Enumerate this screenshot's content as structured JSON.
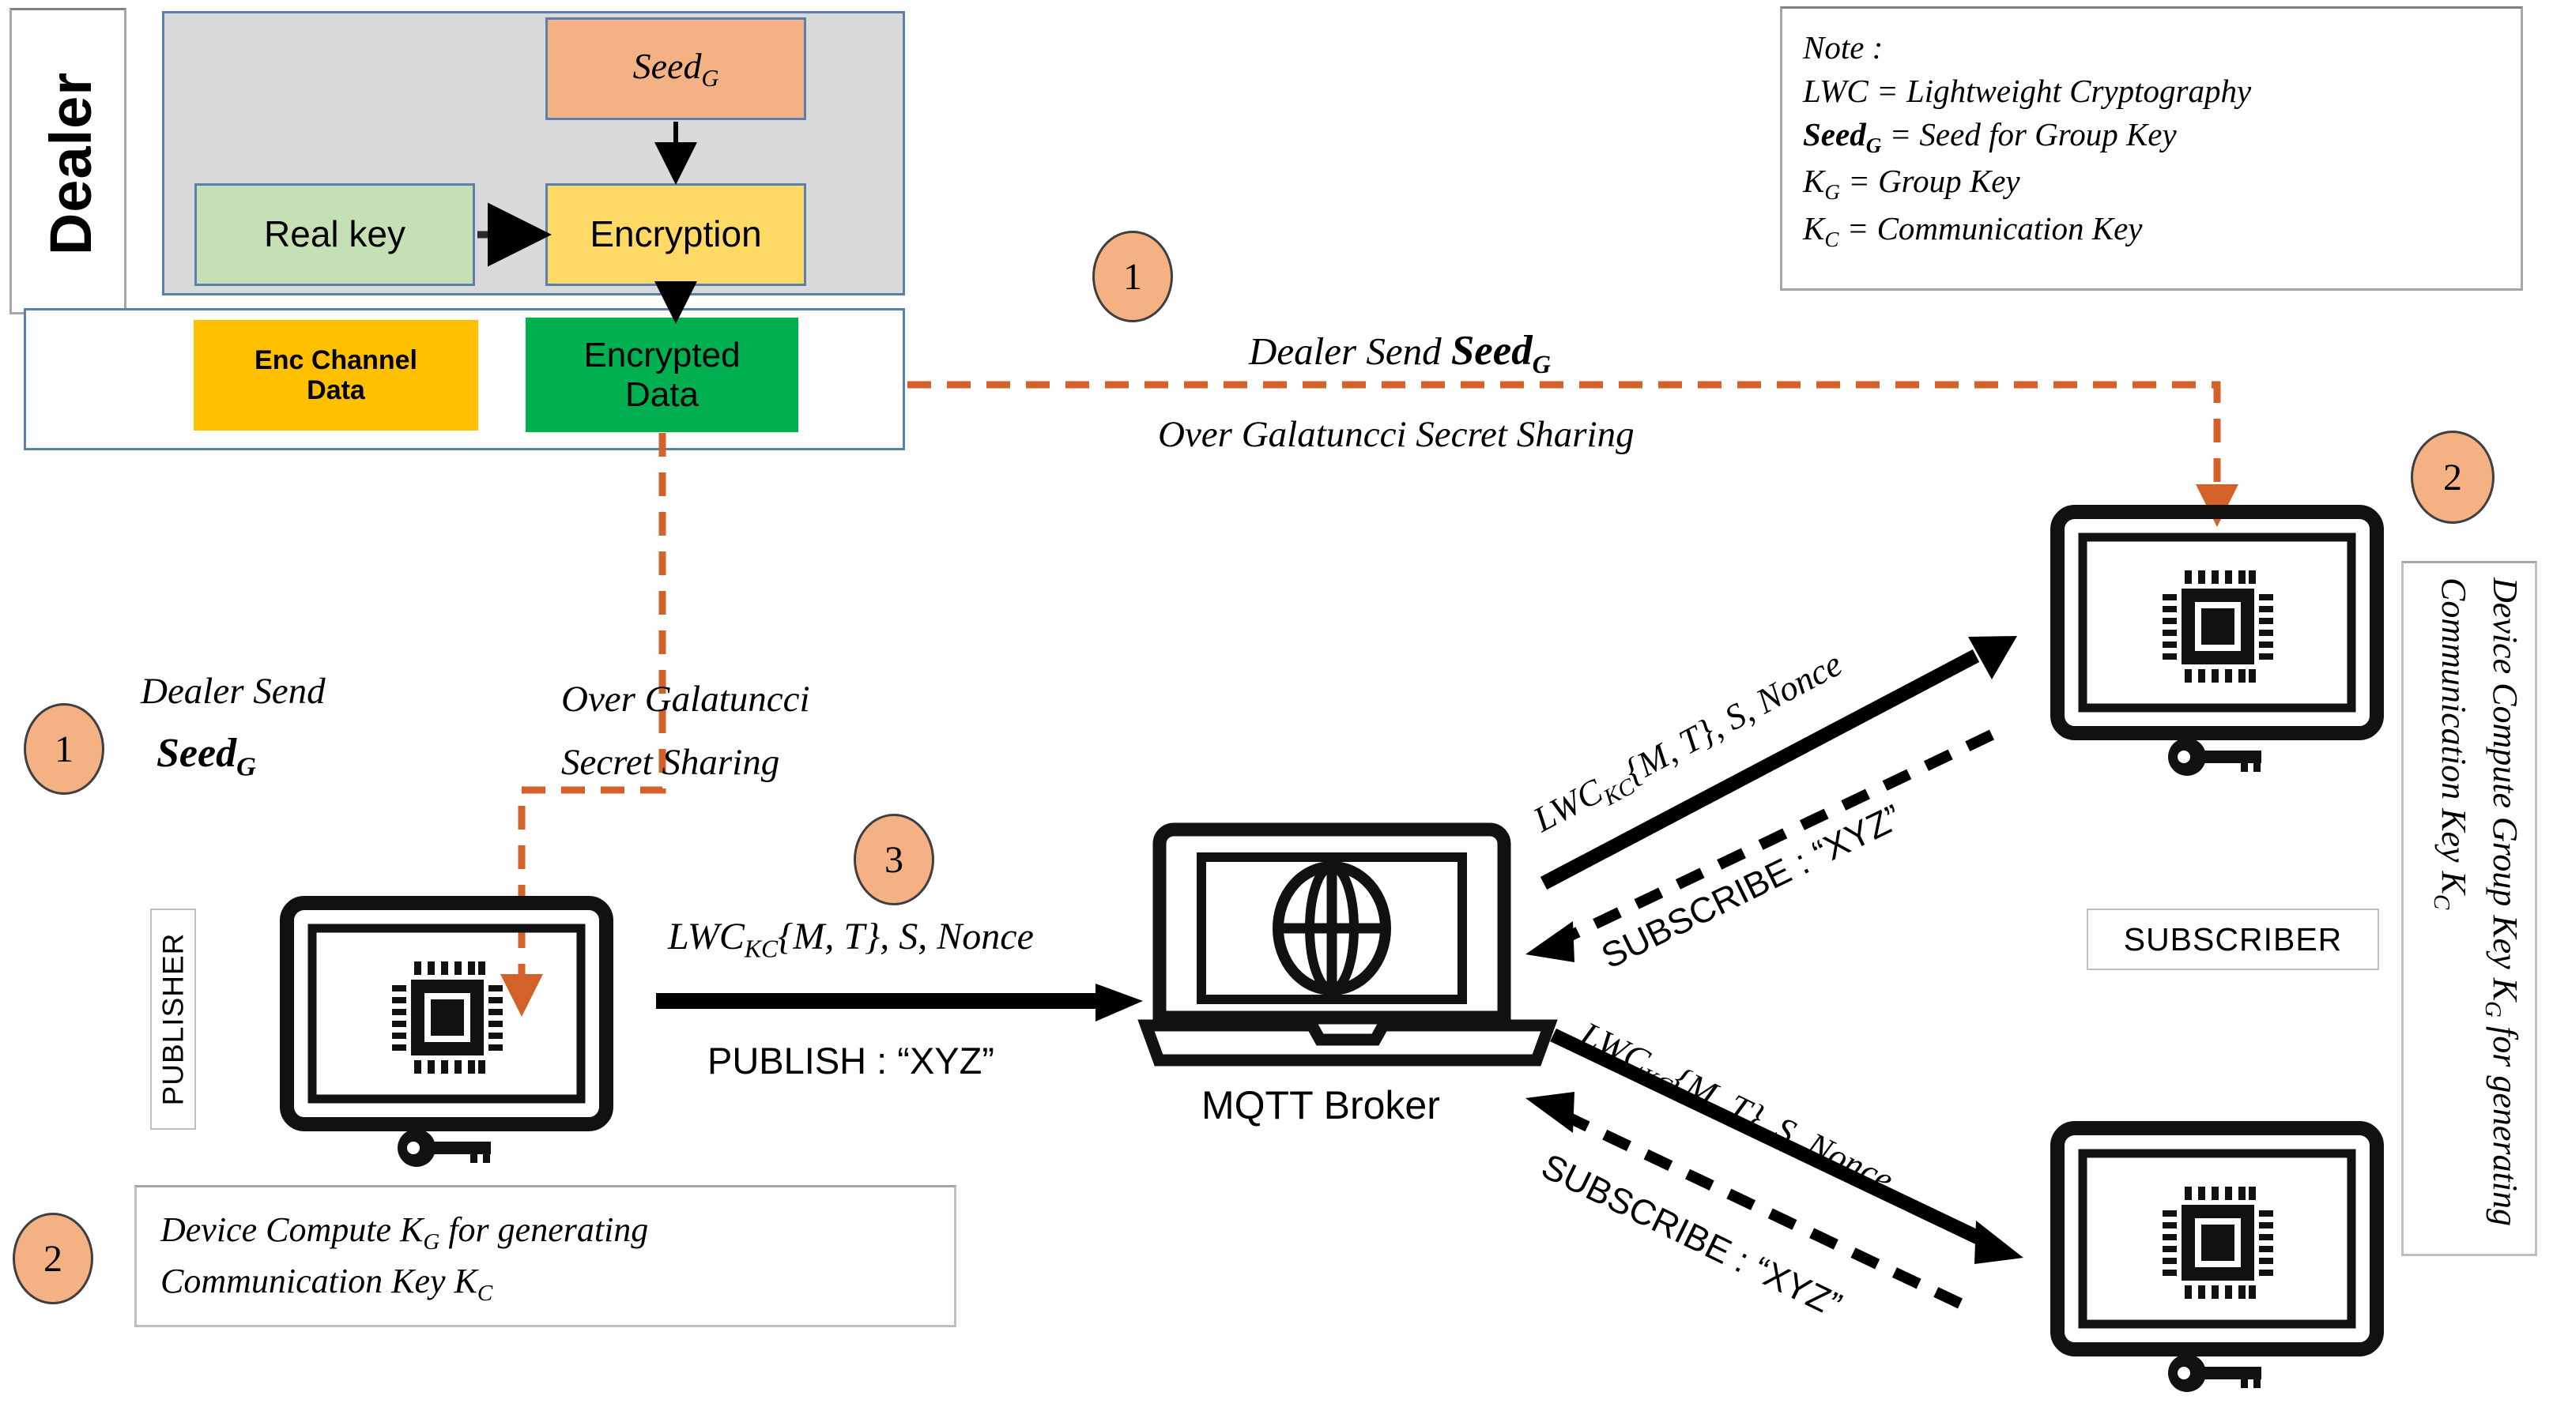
{
  "dealer": {
    "label": "Dealer",
    "boxes": {
      "seed": "Seed",
      "seed_sub": "G",
      "real_key": "Real key",
      "encryption": "Encryption",
      "enc_channel_line1": "Enc Channel",
      "enc_channel_line2": "Data",
      "encrypted_line1": "Encrypted",
      "encrypted_line2": "Data"
    },
    "colors": {
      "seed": "#f4b183",
      "real_key": "#c5e0b4",
      "encryption": "#ffd965",
      "enc_channel": "#ffc000",
      "encrypted": "#00b050",
      "panel": "#d9d9d9",
      "border": "#5b7fae"
    }
  },
  "note": {
    "title": "Note :",
    "lines": [
      "LWC = Lightweight Cryptography",
      "Seed_G = Seed for Group Key",
      "K_G = Group Key",
      "K_C = Communication Key"
    ],
    "line_lwc": "LWC = Lightweight Cryptography",
    "line_seed_pre": "Seed",
    "line_seed_sub": "G",
    "line_seed_post": " = Seed for Group Key",
    "line_kg_pre": "K",
    "line_kg_sub": "G",
    "line_kg_post": " = Group Key",
    "line_kc_pre": "K",
    "line_kc_sub": "C",
    "line_kc_post": " = Communication Key"
  },
  "steps": {
    "one": "1",
    "two": "2",
    "three": "3"
  },
  "flow_top": {
    "label_line1_pre": "Dealer Send ",
    "label_line1_bold": "Seed",
    "label_line1_sub": "G",
    "label_line2": "Over Galatuncci Secret Sharing",
    "color": "#d2622a"
  },
  "flow_left": {
    "label_line1": "Dealer Send",
    "label_line2_bold": "Seed",
    "label_line2_sub": "G",
    "label_right_line1": "Over Galatuncci",
    "label_right_line2": "Secret Sharing"
  },
  "publisher": {
    "tag": "PUBLISHER",
    "icon": "device-chip-icon",
    "key_icon": "key-icon"
  },
  "subscriber": {
    "tag": "SUBSCRIBER",
    "icon": "device-chip-icon",
    "key_icon": "key-icon"
  },
  "broker": {
    "label": "MQTT Broker",
    "icon": "laptop-globe-icon"
  },
  "publish_arrow": {
    "top_pre": "LWC",
    "top_sub": "KC",
    "top_post": "{M, T}, S, Nonce",
    "bottom": "PUBLISH : “XYZ”"
  },
  "sub_top_arrow": {
    "solid_pre": "LWC",
    "solid_sub": "KC",
    "solid_post": "{M, T}, S, Nonce",
    "dashed": "SUBSCRIBE : “XYZ”"
  },
  "sub_bottom_arrow": {
    "solid_pre": "LWC",
    "solid_sub": "KC",
    "solid_post": "{M, T}, S, Nonce",
    "dashed": "SUBSCRIBE : “XYZ”"
  },
  "note_bottom_left": {
    "line1_pre": "Device Compute ",
    "line1_k": "K",
    "line1_sub": "G",
    "line1_post": " for generating",
    "line2_pre": "Communication Key ",
    "line2_k": "K",
    "line2_sub": "C"
  },
  "note_right": {
    "text_pre": "Device Compute Group Key ",
    "text_kg": "K",
    "text_kg_sub": "G",
    "text_mid": " for generating Communication Key ",
    "text_kc": "K",
    "text_kc_sub": "C"
  }
}
